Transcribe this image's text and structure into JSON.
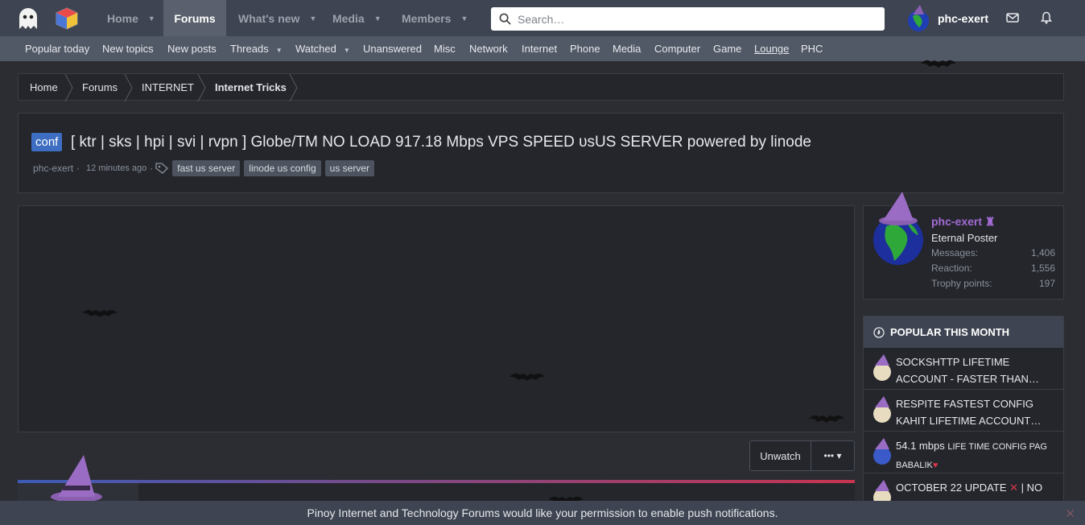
{
  "nav": {
    "tabs": [
      {
        "label": "Home",
        "has_menu": true
      },
      {
        "label": "Forums",
        "active": true
      },
      {
        "label": "What's new",
        "has_menu": true
      },
      {
        "label": "Media",
        "has_menu": true
      },
      {
        "label": "Members",
        "has_menu": true
      }
    ],
    "search_placeholder": "Search…",
    "username": "phc-exert",
    "icons": [
      "ghost-logo",
      "cube-logo",
      "search-icon",
      "envelope-icon",
      "bell-icon"
    ]
  },
  "subnav": {
    "items": [
      {
        "label": "Popular today"
      },
      {
        "label": "New topics"
      },
      {
        "label": "New posts"
      },
      {
        "label": "Threads",
        "has_menu": true
      },
      {
        "label": "Watched",
        "has_menu": true
      },
      {
        "label": "Unanswered"
      },
      {
        "label": "Misc"
      },
      {
        "label": "Network"
      },
      {
        "label": "Internet"
      },
      {
        "label": "Phone"
      },
      {
        "label": "Media"
      },
      {
        "label": "Computer"
      },
      {
        "label": "Game"
      },
      {
        "label": "Lounge",
        "underlined": true
      },
      {
        "label": "PHC"
      }
    ]
  },
  "breadcrumb": [
    "Home",
    "Forums",
    "INTERNET",
    "Internet Tricks"
  ],
  "thread": {
    "prefix": "conf",
    "title": "[ ktr | sks | hpi | svi | rvpn ] Globe/TM NO LOAD 917.18 Mbps VPS SPEED ᴜsUS SERVER powered by linode",
    "author": "phc-exert",
    "separator": "·",
    "time": "12 minutes ago",
    "tags": [
      "fast us server",
      "linode us config",
      "us server"
    ]
  },
  "sidebar_user": {
    "name": "phc-exert",
    "rank": "Eternal Poster",
    "stats": [
      {
        "label": "Messages:",
        "value": "1,406"
      },
      {
        "label": "Reaction:",
        "value": "1,556"
      },
      {
        "label": "Trophy points:",
        "value": "197"
      }
    ]
  },
  "popular": {
    "heading": "POPULAR THIS MONTH",
    "items": [
      {
        "line1": "SOCKSHTTP LIFETIME",
        "line2": "ACCOUNT - FASTER THAN…"
      },
      {
        "line1": "RESPITE FASTEST CONFIG",
        "line2": "KAHIT LIFETIME ACCOUNT…"
      },
      {
        "line1": "54.1 mbps ",
        "line1_small": "LIFE TIME CONFIG PAG",
        "line2": "BABALIK"
      },
      {
        "line1": "OCTOBER 22 UPDATE ",
        "line1_tail": " | NO"
      }
    ]
  },
  "actions": {
    "unwatch": "Unwatch",
    "more": "••• ▾"
  },
  "notification": {
    "message": "Pinoy Internet and Technology Forums would like your permission to enable push notifications.",
    "close": "✕"
  },
  "colors": {
    "accent_blue": "#3e6ec2",
    "username_purple": "#a36bd4",
    "nav_bg": "#3e4451",
    "subnav_bg": "#515866"
  }
}
